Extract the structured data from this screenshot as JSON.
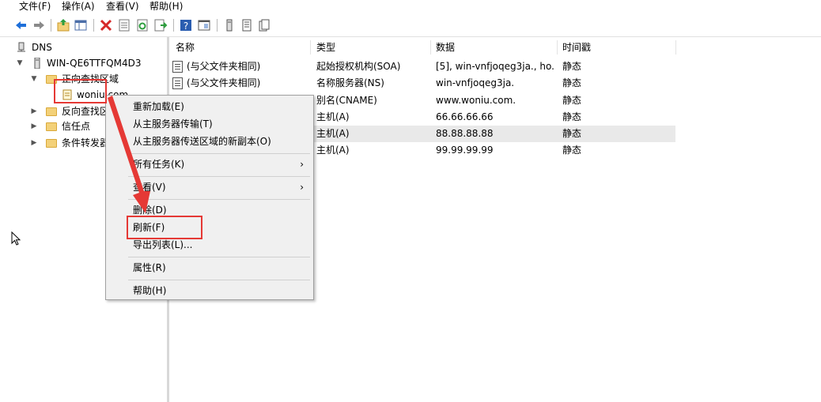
{
  "menubar": {
    "file": "文件(F)",
    "action": "操作(A)",
    "view": "查看(V)",
    "help": "帮助(H)"
  },
  "toolbar": {
    "icons": [
      "back-icon",
      "forward-icon",
      "up-folder-icon",
      "show-hide-tree-icon",
      "delete-icon",
      "properties-icon",
      "refresh-icon",
      "export-list-icon",
      "help-icon",
      "show-console-icon",
      "server-icon",
      "list-icon",
      "copy-icon"
    ]
  },
  "tree": {
    "root": "DNS",
    "server": "WIN-QE6TTFQM4D3",
    "forward_zones": "正向查找区域",
    "zone": "woniu.com",
    "reverse_zones": "反向查找区",
    "trust_points": "信任点",
    "conditional_forwarders": "条件转发器"
  },
  "list": {
    "headers": {
      "name": "名称",
      "type": "类型",
      "data": "数据",
      "timestamp": "时间戳"
    },
    "rows": [
      {
        "name": "(与父文件夹相同)",
        "type": "起始授权机构(SOA)",
        "data": "[5], win-vnfjoqeg3ja., ho...",
        "timestamp": "静态"
      },
      {
        "name": "(与父文件夹相同)",
        "type": "名称服务器(NS)",
        "data": "win-vnfjoqeg3ja.",
        "timestamp": "静态"
      },
      {
        "name": "",
        "type": "别名(CNAME)",
        "data": "www.woniu.com.",
        "timestamp": "静态"
      },
      {
        "name": "",
        "type": "主机(A)",
        "data": "66.66.66.66",
        "timestamp": "静态"
      },
      {
        "name": "",
        "type": "主机(A)",
        "data": "88.88.88.88",
        "timestamp": "静态"
      },
      {
        "name": "",
        "type": "主机(A)",
        "data": "99.99.99.99",
        "timestamp": "静态"
      }
    ]
  },
  "context_menu": {
    "reload": "重新加载(E)",
    "transfer_from_master": "从主服务器传输(T)",
    "transfer_new_copy": "从主服务器传送区域的新副本(O)",
    "all_tasks": "所有任务(K)",
    "view": "查看(V)",
    "delete": "删除(D)",
    "refresh": "刷新(F)",
    "export_list": "导出列表(L)...",
    "properties": "属性(R)",
    "help": "帮助(H)"
  },
  "colors": {
    "highlight": "#e53935",
    "selected_row": "#e9e9e9",
    "menu_bg": "#f0f0f0"
  }
}
